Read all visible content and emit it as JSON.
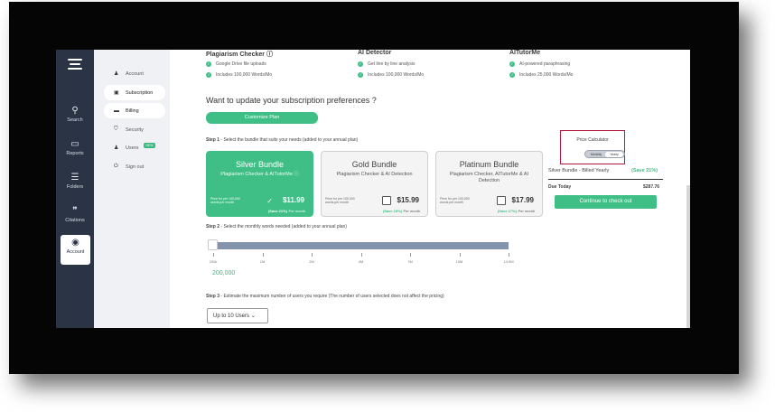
{
  "rail": {
    "items": [
      {
        "label": "Search",
        "icon": "search-icon"
      },
      {
        "label": "Reports",
        "icon": "folder-icon"
      },
      {
        "label": "Folders",
        "icon": "list-icon"
      },
      {
        "label": "Citations",
        "icon": "quote-icon"
      },
      {
        "label": "Account",
        "icon": "user-circle-icon"
      }
    ]
  },
  "subnav": {
    "items": [
      {
        "label": "Account",
        "icon": "person-icon"
      },
      {
        "label": "Subscription",
        "icon": "card-icon"
      },
      {
        "label": "Billing",
        "icon": "billing-icon"
      },
      {
        "label": "Security",
        "icon": "shield-icon"
      },
      {
        "label": "Users",
        "icon": "users-icon",
        "badge": "NEW"
      },
      {
        "label": "Sign out",
        "icon": "signout-icon"
      }
    ]
  },
  "features": {
    "plagiarism": {
      "title": "Plagiarism Checker",
      "items": [
        "Google Drive file uploads",
        "Includes 100,000 Words/Mo"
      ]
    },
    "ai_detector": {
      "title": "AI Detector",
      "items": [
        "Get line by line analysis",
        "Includes 100,000 Words/Mo"
      ]
    },
    "ai_tutor": {
      "title": "AITutorMe",
      "items": [
        "AI-powered paraphrasing",
        "Includes 25,000 Words/Mo"
      ]
    }
  },
  "update_heading": "Want to update your subscription preferences ?",
  "customize_label": "Customize Plan",
  "steps": {
    "s1_num": "Step 1",
    "s1_text": " - Select the bundle that suits your needs (added to your annual plan)",
    "s2_num": "Step 2",
    "s2_text": " - Select the monthly words needed (added to your annual plan)",
    "s3_num": "Step 3",
    "s3_text": " - Estimate the maximum number of users you require (The number of users selected does not affect the pricing)"
  },
  "bundles": [
    {
      "title": "Silver Bundle",
      "desc": "Plagiarism Checker & AITutorMe",
      "per": "Price for per 100,000 words per month",
      "price": "$11.99",
      "save": "(Save 21%)",
      "pm": "Per month"
    },
    {
      "title": "Gold Bundle",
      "desc": "Plagiarism Checker & AI Detection",
      "per": "Price for per 100,000 words per month",
      "price": "$15.99",
      "save": "(Save 15%)",
      "pm": "Per month"
    },
    {
      "title": "Platinum Bundle",
      "desc": "Plagiarism Checker, AITutorMe & AI Detection",
      "per": "Price for per 100,000 words per month",
      "price": "$17.99",
      "save": "(Save 17%)",
      "pm": "Per month"
    }
  ],
  "calculator": {
    "title": "Price Calculator",
    "monthly": "Monthly",
    "yearly": "Yearly",
    "line": "Silver Bundle - Billed Yearly",
    "line_save": "(Save 21%)",
    "due_label": "Due Today",
    "due_value": "$287.76",
    "checkout": "Continue to check out"
  },
  "slider": {
    "ticks": [
      "200k",
      "1M",
      "2M",
      "4M",
      "7M",
      "10M",
      "14.9M"
    ],
    "value": "200,000",
    "fraction": 0
  },
  "users_select": "Up to 10 Users",
  "colors": {
    "accent": "#3fbf86",
    "rail": "#2a3445",
    "highlight": "#b3193a"
  }
}
